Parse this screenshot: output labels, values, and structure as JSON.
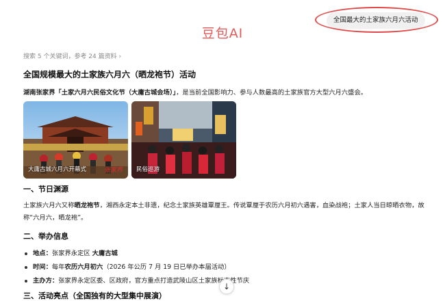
{
  "query": {
    "text": "全国最大的土家族六月六活动"
  },
  "brand": "豆包AI",
  "search_summary": "搜索 5 个关键词，参考 24 篇资料 ›",
  "answer": {
    "title": "全国规模最大的土家族六月六（晒龙袍节）活动",
    "intro_bold": "湖南张家界「土家六月六民俗文化节（大庸古城会场）」",
    "intro_rest": "，是当前全国影响力、参与人数最高的土家族官方大型六月六盛会。",
    "images": [
      {
        "caption": "大庸古城六月六开幕式",
        "watermark": "张家界"
      },
      {
        "caption": "民俗巡游"
      }
    ],
    "section1": {
      "heading": "一、节日渊源",
      "p_a": "土家族六月六又称",
      "p_b": "晒龙袍节",
      "p_c": "，湘西永定本土非遗，纪念土家族英雄覃厘王。传说覃厘于农历六月初六遇害，血染战袍；土家人当日晾晒衣物，故称“六月六，晒龙袍”。"
    },
    "section2": {
      "heading": "二、举办信息",
      "items": [
        {
          "label": "地点：",
          "text": "张家界永定区 ",
          "bold": "大庸古城",
          "tail": ""
        },
        {
          "label": "时间：",
          "text": "每年",
          "bold": "农历六月初六",
          "tail": "（2026 年公历 7 月 19 日已举办本届活动）"
        },
        {
          "label": "主办方：",
          "text": "张家界永定区委、区政府，官方重点打造武陵山区土家族标志性节庆",
          "bold": "",
          "tail": ""
        }
      ]
    },
    "section3": {
      "heading": "三、活动亮点（全国独有的大型集中展演）"
    }
  },
  "scroll_button": {
    "icon": "arrow-down-icon",
    "glyph": "↓"
  }
}
